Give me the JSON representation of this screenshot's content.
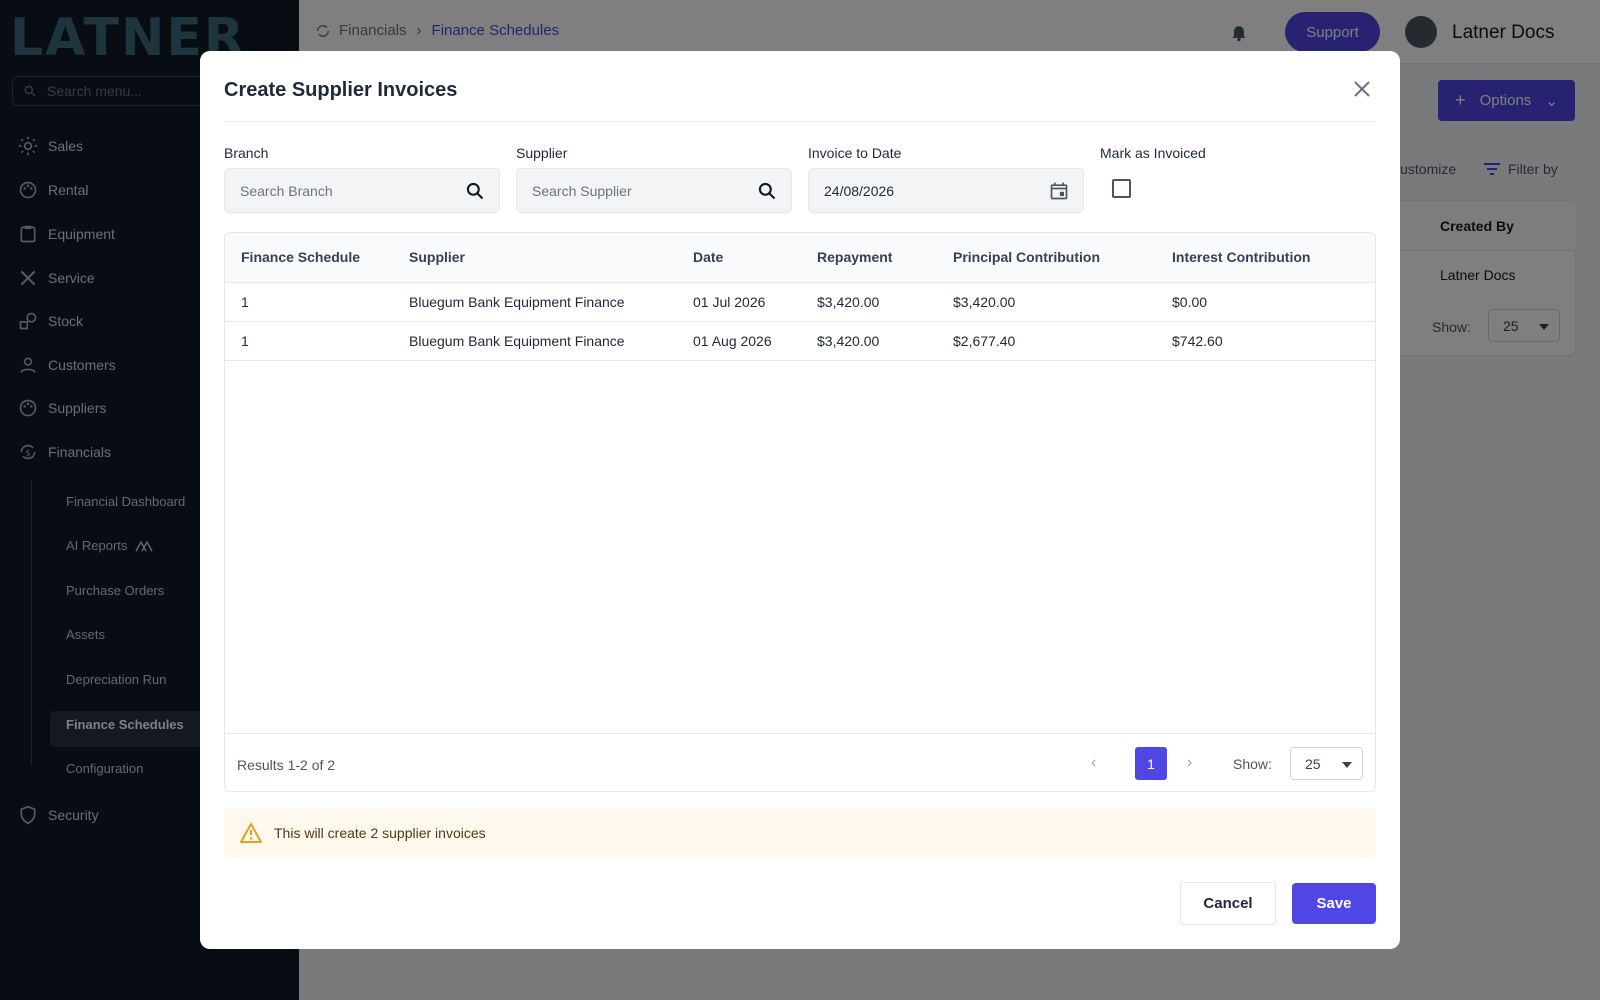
{
  "sidebar": {
    "logo": "LATNER",
    "search_placeholder": "Search menu...",
    "items": [
      {
        "label": "Sales"
      },
      {
        "label": "Rental"
      },
      {
        "label": "Equipment"
      },
      {
        "label": "Service"
      },
      {
        "label": "Stock"
      },
      {
        "label": "Customers"
      },
      {
        "label": "Suppliers"
      },
      {
        "label": "Financials"
      },
      {
        "label": "Security"
      }
    ],
    "financials_sub": [
      {
        "label": "Financial Dashboard"
      },
      {
        "label": "AI Reports"
      },
      {
        "label": "Purchase Orders"
      },
      {
        "label": "Assets"
      },
      {
        "label": "Depreciation Run"
      },
      {
        "label": "Finance Schedules"
      },
      {
        "label": "Configuration"
      }
    ]
  },
  "header": {
    "breadcrumb": [
      "Financials",
      "Finance Schedules"
    ],
    "support_label": "Support",
    "user_name": "Latner Docs"
  },
  "background": {
    "options_label": "Options",
    "customize_label": "Customize",
    "filter_label": "Filter by",
    "created_by_header": "Created By",
    "created_by_value": "Latner Docs",
    "show_label": "Show:",
    "show_value": "25"
  },
  "modal": {
    "title": "Create Supplier Invoices",
    "fields": {
      "branch_label": "Branch",
      "branch_placeholder": "Search Branch",
      "supplier_label": "Supplier",
      "supplier_placeholder": "Search Supplier",
      "date_label": "Invoice to Date",
      "date_value": "24/08/2026",
      "mark_label": "Mark as Invoiced",
      "mark_checked": false
    },
    "table": {
      "columns": [
        "Finance Schedule",
        "Supplier",
        "Date",
        "Repayment",
        "Principal Contribution",
        "Interest Contribution"
      ],
      "rows": [
        [
          "1",
          "Bluegum Bank Equipment Finance",
          "01 Jul 2026",
          "$3,420.00",
          "$3,420.00",
          "$0.00"
        ],
        [
          "1",
          "Bluegum Bank Equipment Finance",
          "01 Aug 2026",
          "$3,420.00",
          "$2,677.40",
          "$742.60"
        ]
      ],
      "results": "Results 1-2 of 2",
      "page": "1",
      "show_label": "Show:",
      "show_value": "25"
    },
    "warning": "This will create 2 supplier invoices",
    "cancel_label": "Cancel",
    "save_label": "Save"
  },
  "colors": {
    "accent": "#4f46e5",
    "sidebar_bg": "#0f1a24",
    "warning_bg": "#fff8ec",
    "warning_icon": "#e0a020"
  }
}
